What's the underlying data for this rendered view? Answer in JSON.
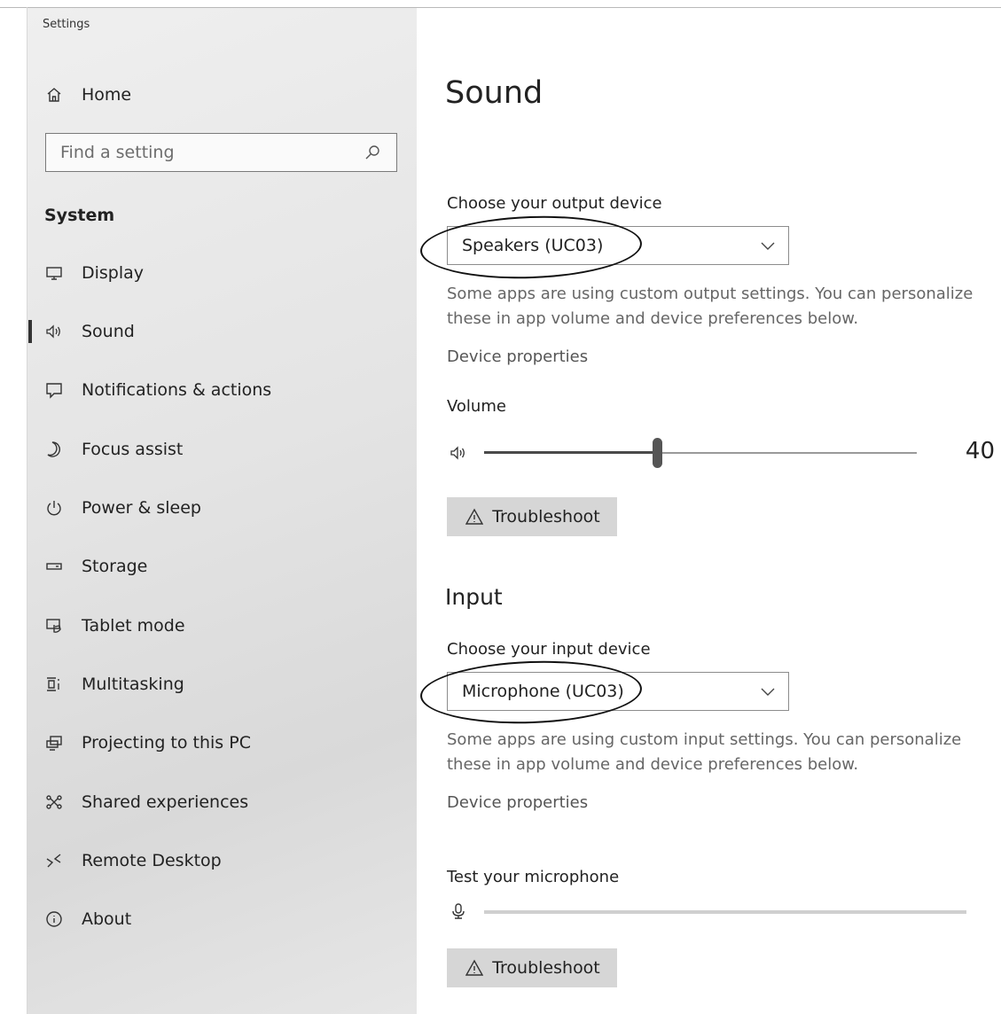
{
  "window": {
    "title": "Settings"
  },
  "sidebar": {
    "home_label": "Home",
    "search_placeholder": "Find a setting",
    "section": "System",
    "items": [
      {
        "label": "Display",
        "icon": "monitor-icon"
      },
      {
        "label": "Sound",
        "icon": "speaker-icon",
        "active": true
      },
      {
        "label": "Notifications & actions",
        "icon": "notification-icon"
      },
      {
        "label": "Focus assist",
        "icon": "moon-icon"
      },
      {
        "label": "Power & sleep",
        "icon": "power-icon"
      },
      {
        "label": "Storage",
        "icon": "storage-icon"
      },
      {
        "label": "Tablet mode",
        "icon": "tablet-mode-icon"
      },
      {
        "label": "Multitasking",
        "icon": "multitasking-icon"
      },
      {
        "label": "Projecting to this PC",
        "icon": "projecting-icon"
      },
      {
        "label": "Shared experiences",
        "icon": "shared-experiences-icon"
      },
      {
        "label": "Remote Desktop",
        "icon": "remote-desktop-icon"
      },
      {
        "label": "About",
        "icon": "info-icon"
      }
    ]
  },
  "main": {
    "title": "Sound",
    "output": {
      "label": "Choose your output device",
      "device": "Speakers (UC03)",
      "note": "Some apps are using custom output settings. You can personalize these in app volume and device preferences below.",
      "properties_link": "Device properties",
      "volume_label": "Volume",
      "volume_value": "40",
      "volume_level": 40,
      "troubleshoot": "Troubleshoot"
    },
    "input": {
      "heading": "Input",
      "label": "Choose your input device",
      "device": "Microphone (UC03)",
      "note": "Some apps are using custom input settings. You can personalize these in app volume and device preferences below.",
      "properties_link": "Device properties",
      "test_label": "Test your microphone",
      "troubleshoot": "Troubleshoot"
    }
  },
  "colors": {
    "sidebar_bg": "#e6e6e6",
    "button_bg": "#d6d6d6",
    "text": "#222222",
    "muted": "#666666"
  }
}
